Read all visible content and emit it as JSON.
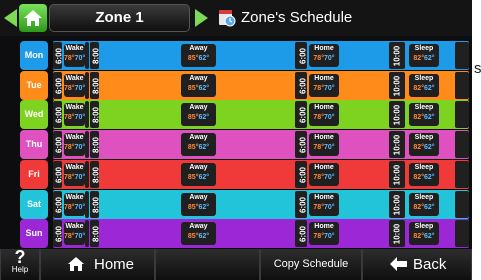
{
  "header": {
    "zone_label": "Zone 1",
    "schedule_title": "Zone's Schedule"
  },
  "side_label": "s",
  "days": [
    {
      "label": "Mon",
      "color": "#1e9be8"
    },
    {
      "label": "Tue",
      "color": "#ff8c1a"
    },
    {
      "label": "Wed",
      "color": "#7ed321"
    },
    {
      "label": "Thu",
      "color": "#e051c0"
    },
    {
      "label": "Fri",
      "color": "#f03a3a"
    },
    {
      "label": "Sat",
      "color": "#21c4d8"
    },
    {
      "label": "Sun",
      "color": "#9b27d6"
    }
  ],
  "periods": {
    "wake": {
      "name": "Wake",
      "heat": "78°",
      "cool": "70°",
      "start": "6:00",
      "end": "8:00"
    },
    "away": {
      "name": "Away",
      "heat": "85°",
      "cool": "62°"
    },
    "home": {
      "name": "Home",
      "heat": "78°",
      "cool": "70°",
      "start": "6:00"
    },
    "sleep": {
      "name": "Sleep",
      "heat": "82°",
      "cool": "62°",
      "start": "10:00"
    }
  },
  "footer": {
    "help_symbol": "?",
    "help_label": "Help",
    "home_label": "Home",
    "copy_label": "Copy Schedule",
    "back_label": "Back"
  }
}
